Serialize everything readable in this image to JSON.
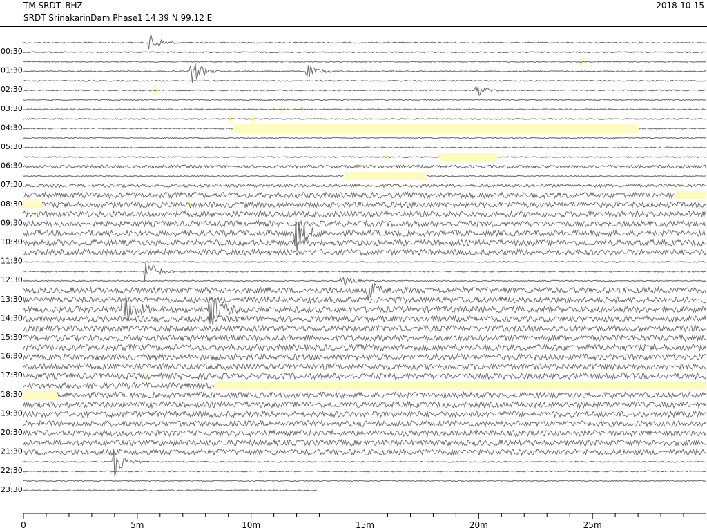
{
  "header": {
    "station": "TM.SRDT..BHZ",
    "description": "SRDT SrinakarinDam Phase1  14.39 N 99.12 E",
    "date": "2018-10-15"
  },
  "colors": {
    "trace": "#707070",
    "gap": "#fffac0",
    "axis": "#000000"
  },
  "chart_data": {
    "type": "line",
    "chart_kind": "helicorder",
    "xlabel": "",
    "ylabel": "",
    "xlim": [
      0,
      30
    ],
    "x_unit": "minutes",
    "x_ticks": [
      {
        "v": 0,
        "label": "0"
      },
      {
        "v": 5,
        "label": "5m"
      },
      {
        "v": 10,
        "label": "10m"
      },
      {
        "v": 15,
        "label": "15m"
      },
      {
        "v": 20,
        "label": "20m"
      },
      {
        "v": 25,
        "label": "25m"
      }
    ],
    "row_labels": [
      "00:30",
      "01:30",
      "02:30",
      "03:30",
      "04:30",
      "05:30",
      "06:30",
      "07:30",
      "08:30",
      "09:30",
      "10:30",
      "11:30",
      "12:30",
      "13:30",
      "14:30",
      "15:30",
      "16:30",
      "17:30",
      "18:30",
      "19:30",
      "20:30",
      "21:30",
      "22:30",
      "23:30"
    ],
    "rows_per_label": 2,
    "trace_rows": 48,
    "data_end": {
      "row": 47,
      "minute": 13.0
    },
    "row_noise_level": [
      1,
      1,
      1,
      1,
      1,
      1,
      1,
      1,
      1,
      1,
      1,
      1,
      1,
      2,
      1,
      2,
      3,
      3,
      3,
      3,
      3,
      3,
      3,
      1,
      1,
      1,
      3,
      3,
      3,
      3,
      3,
      3,
      3,
      3,
      3,
      3,
      3,
      3,
      3,
      3,
      3,
      3,
      3,
      3,
      1,
      1,
      1,
      1
    ],
    "events": [
      {
        "row": 0,
        "minute": 5.6,
        "amp": 2
      },
      {
        "row": 3,
        "minute": 7.4,
        "amp": 3
      },
      {
        "row": 3,
        "minute": 12.5,
        "amp": 1.5
      },
      {
        "row": 5,
        "minute": 19.9,
        "amp": 1.5
      },
      {
        "row": 20,
        "minute": 12.0,
        "amp": 4
      },
      {
        "row": 24,
        "minute": 5.4,
        "amp": 3
      },
      {
        "row": 25,
        "minute": 14.0,
        "amp": 1.5
      },
      {
        "row": 26,
        "minute": 15.2,
        "amp": 1.8
      },
      {
        "row": 28,
        "minute": 4.4,
        "amp": 4
      },
      {
        "row": 28,
        "minute": 8.2,
        "amp": 4.5
      },
      {
        "row": 44,
        "minute": 4.0,
        "amp": 3.5
      }
    ],
    "gaps": [
      {
        "row": 2,
        "start": 24.4,
        "end": 24.6
      },
      {
        "row": 5,
        "start": 5.7,
        "end": 5.9
      },
      {
        "row": 7,
        "start": 11.3,
        "end": 11.4
      },
      {
        "row": 7,
        "start": 12.2,
        "end": 12.3
      },
      {
        "row": 8,
        "start": 9.0,
        "end": 9.2
      },
      {
        "row": 8,
        "start": 10.0,
        "end": 10.2
      },
      {
        "row": 9,
        "start": 9.2,
        "end": 27.0
      },
      {
        "row": 12,
        "start": 15.9,
        "end": 16.0
      },
      {
        "row": 12,
        "start": 18.3,
        "end": 20.8
      },
      {
        "row": 14,
        "start": 14.1,
        "end": 17.7
      },
      {
        "row": 14,
        "start": 17.2,
        "end": 17.3
      },
      {
        "row": 16,
        "start": 28.6,
        "end": 30.0
      },
      {
        "row": 17,
        "start": 0.0,
        "end": 0.8
      },
      {
        "row": 17,
        "start": 7.2,
        "end": 7.4
      },
      {
        "row": 35,
        "start": 5.4,
        "end": 5.5
      },
      {
        "row": 36,
        "start": 8.4,
        "end": 30.0
      },
      {
        "row": 37,
        "start": 0.0,
        "end": 1.5
      }
    ]
  }
}
